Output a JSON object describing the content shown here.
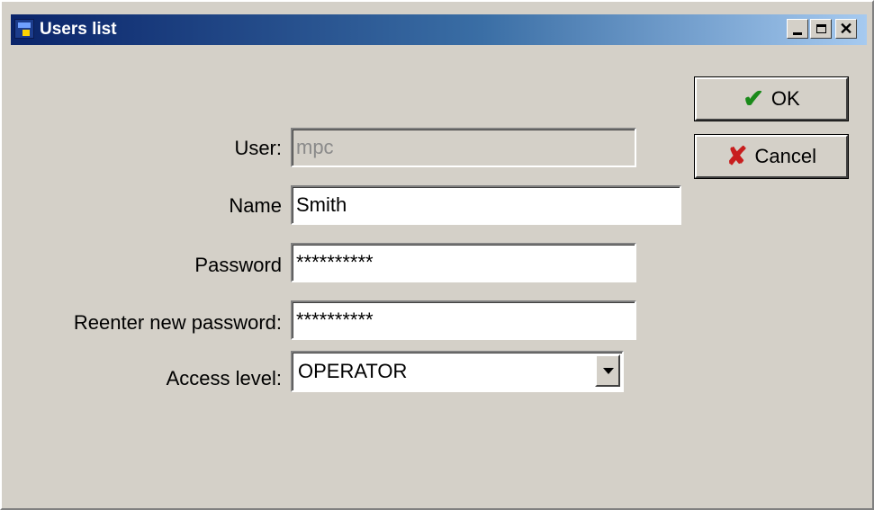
{
  "window": {
    "title": "Users list",
    "minimize_icon": "minimize-icon",
    "maximize_icon": "maximize-icon",
    "close_icon": "close-icon"
  },
  "form": {
    "user": {
      "label": "User:",
      "value": "mpc",
      "disabled": true
    },
    "name": {
      "label": "Name",
      "value": "Smith"
    },
    "password": {
      "label": "Password",
      "value": "**********"
    },
    "reenter_password": {
      "label": "Reenter new password:",
      "value": "**********"
    },
    "access_level": {
      "label": "Access level:",
      "selected": "OPERATOR"
    }
  },
  "buttons": {
    "ok": {
      "label": "OK",
      "icon": "checkmark-icon",
      "icon_color": "#1a8a1a"
    },
    "cancel": {
      "label": "Cancel",
      "icon": "x-icon",
      "icon_color": "#c81e1e"
    }
  },
  "colors": {
    "title_gradient_start": "#0a246a",
    "title_gradient_end": "#a6caf0",
    "dialog_bg": "#d4d0c8"
  }
}
